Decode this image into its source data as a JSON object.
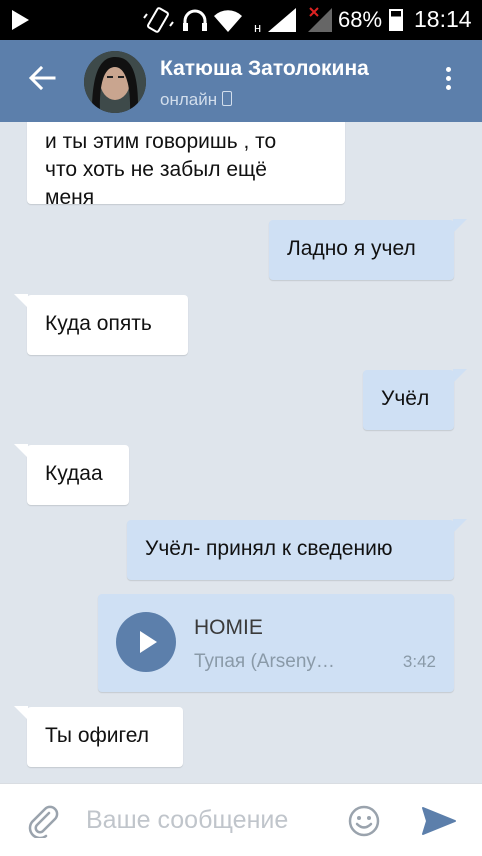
{
  "status_bar": {
    "battery": "68%",
    "time": "18:14",
    "network_type": "н",
    "icons": [
      "play-icon",
      "vibrate-icon",
      "headset-icon",
      "wifi-icon",
      "signal-icon",
      "signal-no-data-icon",
      "battery-icon"
    ]
  },
  "header": {
    "name": "Катюша Затолокина",
    "status": "онлайн",
    "icons": {
      "back": "arrow-left-icon",
      "menu": "more-vertical-icon",
      "mobile": "mobile-phone-icon"
    },
    "color": "#5c7fab"
  },
  "messages": [
    {
      "direction": "in",
      "text": "и ты этим говоришь , то\nчто хоть не забыл ещё\nменя"
    },
    {
      "direction": "out",
      "text": "Ладно я учел"
    },
    {
      "direction": "in",
      "text": "Куда опять"
    },
    {
      "direction": "out",
      "text": "Учёл"
    },
    {
      "direction": "in",
      "text": "Кудаа"
    },
    {
      "direction": "out",
      "text": "Учёл- принял к сведению"
    },
    {
      "direction": "out",
      "type": "audio",
      "title": "HOMIE",
      "artist": "Тупая (Arseny…",
      "duration": "3:42"
    },
    {
      "direction": "in",
      "text": "Ты офигел"
    }
  ],
  "input": {
    "placeholder": "Ваше сообщение",
    "value": "",
    "icons": {
      "attach": "paperclip-icon",
      "emoji": "smiley-icon",
      "send": "send-icon"
    }
  },
  "colors": {
    "incoming_bubble": "#ffffff",
    "outgoing_bubble": "#cfe0f4",
    "background": "#dfe5ec",
    "accent": "#5c7fab"
  }
}
